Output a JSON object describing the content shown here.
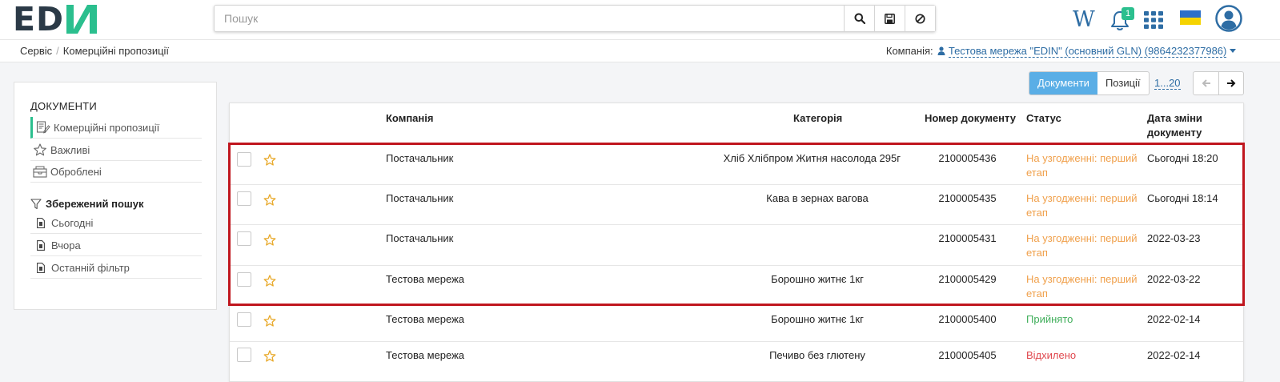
{
  "header": {
    "logo_text": "ED",
    "search": {
      "placeholder": "Пошук",
      "value": ""
    },
    "wiki_icon_text": "W",
    "notifications_count": "1",
    "brand_color": "#2bbf8e"
  },
  "breadcrumb": {
    "items": [
      "Сервіс",
      "Комерційні пропозиції"
    ]
  },
  "company": {
    "label": "Компанія:",
    "name": "Тестова мережа \"EDIN\" (основний GLN) (9864232377986)"
  },
  "sidebar": {
    "heading": "ДОКУМЕНТИ",
    "items": [
      {
        "label": "Комерційні пропозиції",
        "icon": "document-edit-icon"
      },
      {
        "label": "Важливі",
        "icon": "star-outline-icon"
      },
      {
        "label": "Оброблені",
        "icon": "archive-box-icon"
      }
    ],
    "saved_heading": "Збережений пошук",
    "saved": [
      {
        "label": "Сьогодні",
        "icon": "file-icon"
      },
      {
        "label": "Вчора",
        "icon": "file-icon"
      },
      {
        "label": "Останній фільтр",
        "icon": "file-icon"
      }
    ]
  },
  "toolbar": {
    "toggle": [
      "Документи",
      "Позиції"
    ],
    "range": "1...20"
  },
  "table": {
    "columns": {
      "company": "Компанія",
      "category": "Категорія",
      "number": "Номер документу",
      "status": "Статус",
      "date_line1": "Дата зміни",
      "date_line2": "документу"
    },
    "rows": [
      {
        "company": "Постачальник",
        "category": "Хліб Хлібпром Житня насолода 295г",
        "number": "2100005436",
        "status_line1": "На узгодженні: перший",
        "status_line2": "етап",
        "status_color": "orange",
        "date": "Сьогодні 18:20"
      },
      {
        "company": "Постачальник",
        "category": "Кава в зернах вагова",
        "number": "2100005435",
        "status_line1": "На узгодженні: перший",
        "status_line2": "етап",
        "status_color": "orange",
        "date": "Сьогодні 18:14"
      },
      {
        "company": "Постачальник",
        "category": "",
        "number": "2100005431",
        "status_line1": "На узгодженні: перший",
        "status_line2": "етап",
        "status_color": "orange",
        "date": "2022-03-23"
      },
      {
        "company": "Тестова мережа",
        "category": "Борошно житнє 1кг",
        "number": "2100005429",
        "status_line1": "На узгодженні: перший",
        "status_line2": "етап",
        "status_color": "orange",
        "date": "2022-03-22"
      },
      {
        "company": "Тестова мережа",
        "category": "Борошно житнє 1кг",
        "number": "2100005400",
        "status_line1": "Прийнято",
        "status_line2": "",
        "status_color": "green",
        "date": "2022-02-14"
      },
      {
        "company": "Тестова мережа",
        "category": "Печиво без глютену",
        "number": "2100005405",
        "status_line1": "Відхилено",
        "status_line2": "",
        "status_color": "red",
        "date": "2022-02-14"
      }
    ]
  },
  "colors": {
    "accent": "#2bbf8e",
    "link": "#2e6da4",
    "status_orange": "#f0a04b",
    "status_green": "#3fae5a",
    "status_red": "#e0484e",
    "highlight": "#c0161e"
  }
}
